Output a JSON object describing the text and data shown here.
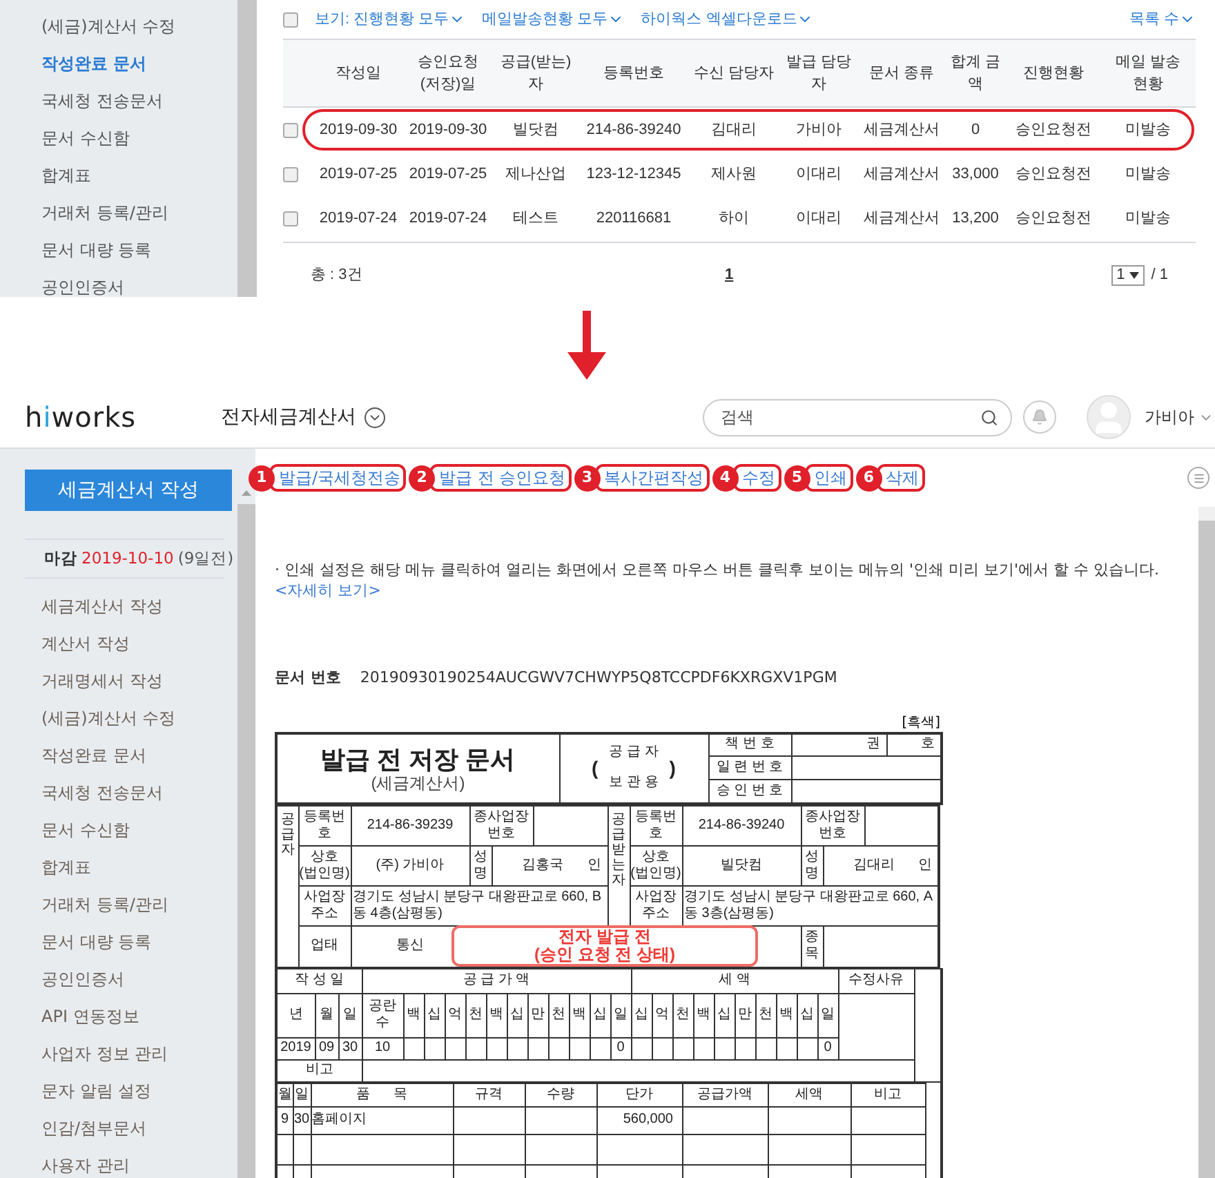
{
  "top_panel": {
    "sidebar_items": [
      {
        "label": "(세금)계산서 수정",
        "selected": false
      },
      {
        "label": "작성완료 문서",
        "selected": true
      },
      {
        "label": "국세청 전송문서",
        "selected": false
      },
      {
        "label": "문서 수신함",
        "selected": false
      },
      {
        "label": "합계표",
        "selected": false
      },
      {
        "label": "거래처 등록/관리",
        "selected": false
      },
      {
        "label": "문서 대량 등록",
        "selected": false
      },
      {
        "label": "공인인증서",
        "selected": false
      }
    ],
    "select_all_checked": false,
    "filters": [
      "보기: 진행현황 모두",
      "메일발송현황 모두",
      "하이웍스 엑셀다운로드"
    ],
    "list_count": "목록 수",
    "columns": [
      "작성일",
      "승인요청\n(저장)일",
      "공급(받는)자",
      "등록번호",
      "수신 담당자",
      "발급 담당자",
      "문서 종류",
      "합계 금액",
      "진행현황",
      "메일 발송\n현황"
    ],
    "rows": [
      {
        "checked": false,
        "highlighted": true,
        "cells": [
          "2019-09-30",
          "2019-09-30",
          "빌닷컴",
          "214-86-39240",
          "김대리",
          "가비아",
          "세금계산서",
          "0",
          "승인요청전",
          "미발송"
        ]
      },
      {
        "checked": false,
        "highlighted": false,
        "cells": [
          "2019-07-25",
          "2019-07-25",
          "제나산업",
          "123-12-12345",
          "제사원",
          "이대리",
          "세금계산서",
          "33,000",
          "승인요청전",
          "미발송"
        ]
      },
      {
        "checked": false,
        "highlighted": false,
        "cells": [
          "2019-07-24",
          "2019-07-24",
          "테스트",
          "220116681",
          "하이",
          "이대리",
          "세금계산서",
          "13,200",
          "승인요청전",
          "미발송"
        ]
      }
    ],
    "total": "총 : 3건",
    "page": "1",
    "page_select": "1",
    "page_count": "/ 1"
  },
  "header": {
    "logo": "hiworks",
    "app_title": "전자세금계산서",
    "search_placeholder": "검색",
    "user": "가비아"
  },
  "sidebar": {
    "write_button": "세금계산서 작성",
    "deadline": {
      "label": "마감",
      "date": "2019-10-10",
      "remaining": "(9일전)"
    },
    "items": [
      "세금계산서 작성",
      "계산서 작성",
      "거래명세서 작성",
      "(세금)계산서 수정",
      "작성완료 문서",
      "국세청 전송문서",
      "문서 수신함",
      "합계표",
      "거래처 등록/관리",
      "문서 대량 등록",
      "공인인증서",
      "API 연동정보",
      "사업자 정보 관리",
      "문자 알림 설정",
      "인감/첨부문서",
      "사용자 관리"
    ]
  },
  "actions": [
    {
      "number": "1",
      "label": "발급/국세청전송"
    },
    {
      "number": "2",
      "label": "발급 전 승인요청"
    },
    {
      "number": "3",
      "label": "복사간편작성"
    },
    {
      "number": "4",
      "label": "수정"
    },
    {
      "number": "5",
      "label": "인쇄"
    },
    {
      "number": "6",
      "label": "삭제"
    }
  ],
  "notice": {
    "text": "· 인쇄 설정은 해당 메뉴 클릭하여 열리는 화면에서 오른쪽 마우스 버튼 클릭후 보이는 메뉴의 '인쇄 미리 보기'에서 할 수 있습니다.",
    "link": "<자세히 보기>"
  },
  "document_number": {
    "label": "문서 번호",
    "value": "20190930190254AUCGWV7CHWYP5Q8TCCPDF6KXRGXV1PGM"
  },
  "invoice": {
    "color_label": "[흑색]",
    "title": "발급 전 저장 문서",
    "subtitle": "(세금계산서)",
    "copy_type": {
      "open": "(",
      "lines": [
        "공 급 자",
        "보 관 용"
      ],
      "close": ")"
    },
    "book_label": "책 번 호",
    "volume": "권",
    "number": "호",
    "serial_label": "일 련 번 호",
    "approval_label": "승 인 번 호",
    "parties": [
      {
        "side_label": "공급자",
        "reg_label": "등록번호",
        "reg_no": "214-86-39239",
        "branch_label": "종사업장\n번호",
        "name_label": "상호\n(법인명)",
        "company": "(주) 가비아",
        "rep_label": "성\n명",
        "representative": "김홍국",
        "seal": "인",
        "address_label": "사업장\n주소",
        "address": "경기도 성남시 분당구 대왕판교로 660, B동 4층(삼평동)",
        "business_type_label": "업태",
        "business_type": "통신"
      },
      {
        "side_label": "공급받는자",
        "reg_label": "등록번호",
        "reg_no": "214-86-39240",
        "branch_label": "종사업장\n번호",
        "name_label": "상호\n(법인명)",
        "company": "빌닷컴",
        "rep_label": "성\n명",
        "representative": "김대리",
        "seal": "인",
        "address_label": "사업장\n주소",
        "address": "경기도 성남시 분당구 대왕판교로 660, A동 3층(삼평동)",
        "item_label": "종\n목"
      }
    ],
    "stamp": [
      "전자 발급 전",
      "(승인 요청 전 상태)"
    ],
    "amounts": {
      "date_label": "작 성 일",
      "supply_label": "공 급 가 액",
      "tax_label": "세 액",
      "reason_label": "수정사유",
      "date_columns": [
        "년",
        "월",
        "일",
        "공란\n수"
      ],
      "supply_digits": [
        "백",
        "십",
        "억",
        "천",
        "백",
        "십",
        "만",
        "천",
        "백",
        "십",
        "일"
      ],
      "tax_digits": [
        "십",
        "억",
        "천",
        "백",
        "십",
        "만",
        "천",
        "백",
        "십",
        "일"
      ],
      "date_values": [
        "2019",
        "09",
        "30",
        "10"
      ],
      "supply_amount": "0",
      "tax_amount": "0",
      "remarks_label": "비고"
    },
    "items": {
      "columns": [
        "월",
        "일",
        "품      목",
        "규격",
        "수량",
        "단가",
        "공급가액",
        "세액",
        "비고"
      ],
      "rows": [
        {
          "cells": [
            "9",
            "30",
            "홈페이지",
            "",
            "",
            "560,000",
            "",
            "",
            ""
          ]
        }
      ]
    }
  }
}
